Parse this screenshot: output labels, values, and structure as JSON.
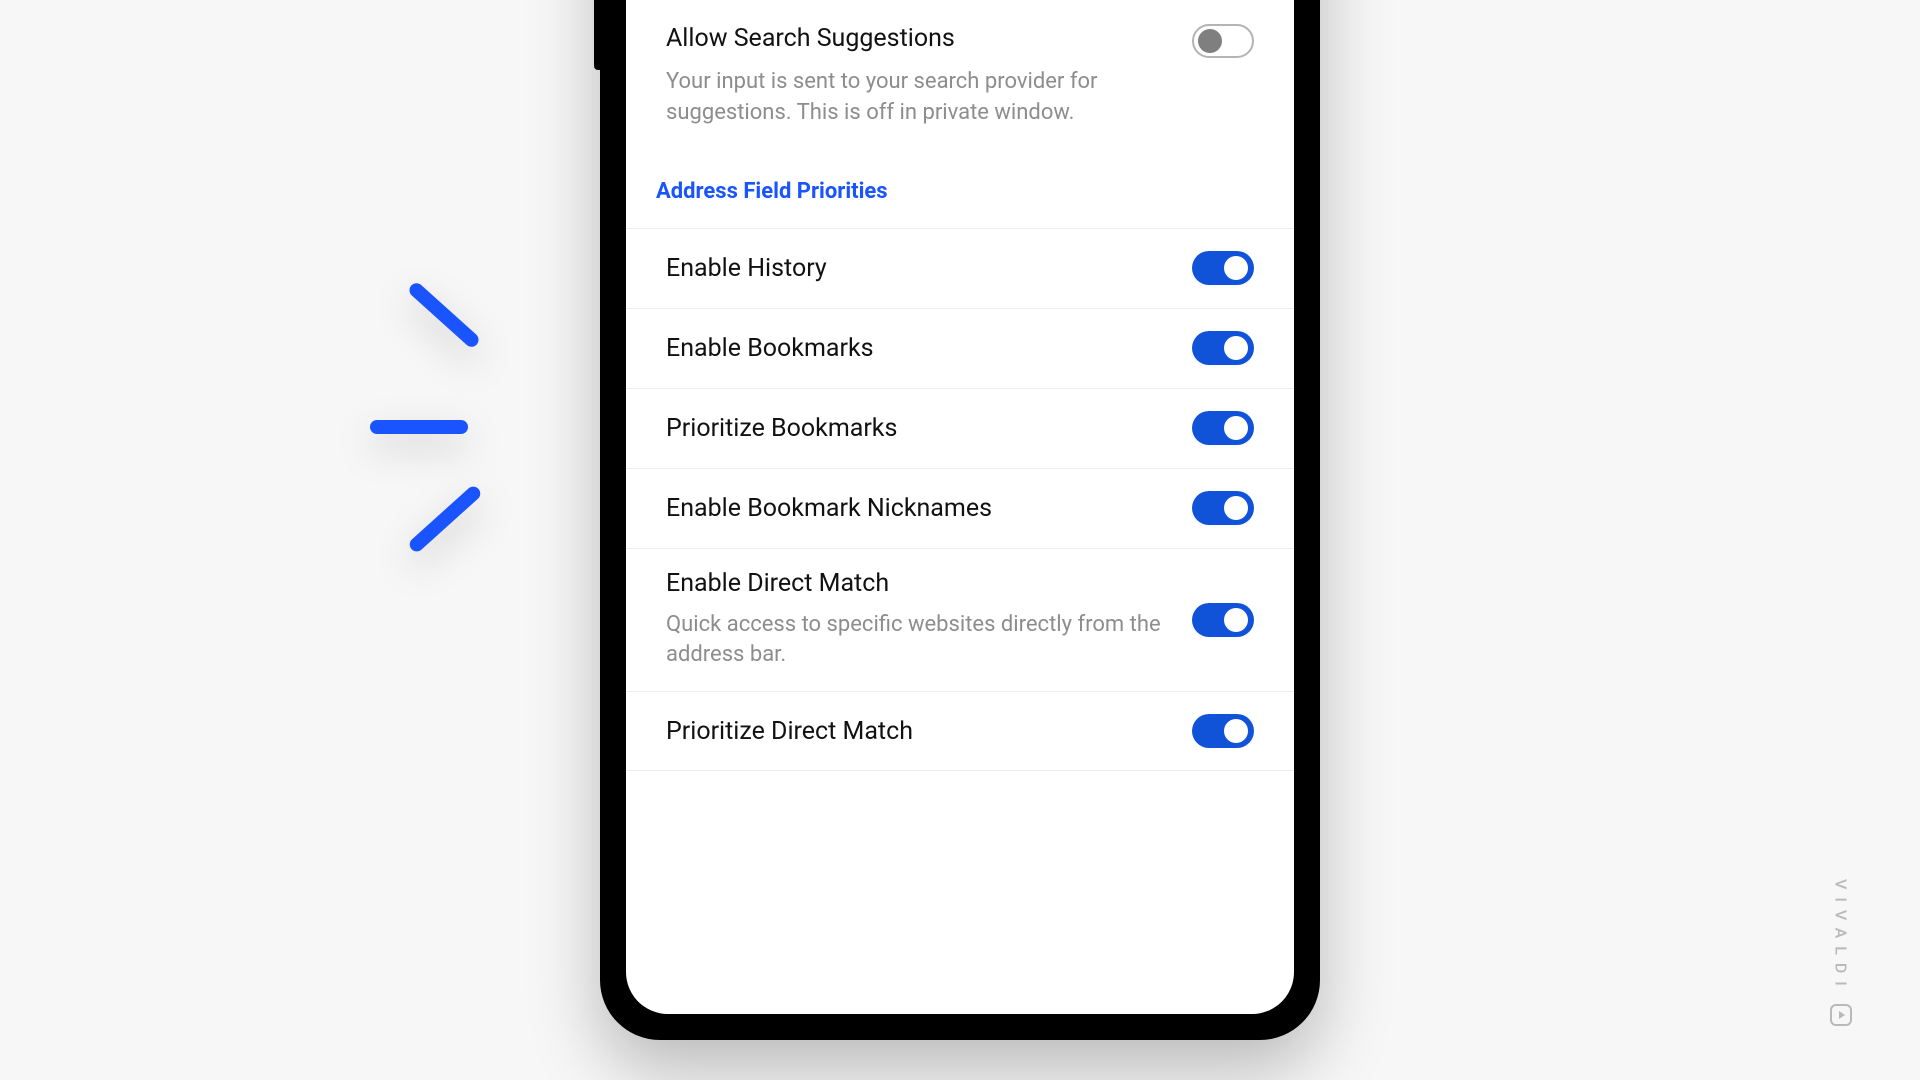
{
  "top": {
    "title": "Allow Search Suggestions",
    "description": "Your input is sent to your search provider for suggestions. This is off in private window.",
    "enabled": false
  },
  "section_header": "Address Field Priorities",
  "rows": [
    {
      "title": "Enable History",
      "description": "",
      "enabled": true
    },
    {
      "title": "Enable Bookmarks",
      "description": "",
      "enabled": true
    },
    {
      "title": "Prioritize Bookmarks",
      "description": "",
      "enabled": true
    },
    {
      "title": "Enable Bookmark Nicknames",
      "description": "",
      "enabled": true
    },
    {
      "title": "Enable Direct Match",
      "description": "Quick access to specific websites directly from the address bar.",
      "enabled": true
    },
    {
      "title": "Prioritize Direct Match",
      "description": "",
      "enabled": true
    }
  ],
  "brand": "VIVALDI"
}
